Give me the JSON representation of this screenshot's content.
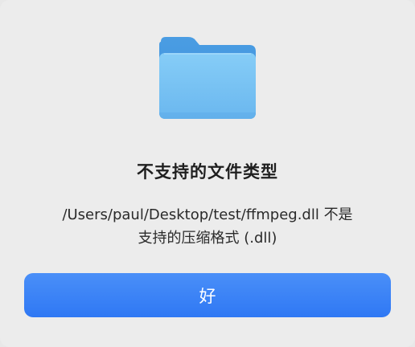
{
  "dialog": {
    "icon": "folder-icon",
    "title": "不支持的文件类型",
    "message_line1": "/Users/paul/Desktop/test/ffmpeg.dll 不是",
    "message_line2": "支持的压缩格式 (.dll)",
    "ok_label": "好"
  },
  "colors": {
    "accent": "#2f78f4",
    "folder_front": "#7cc4f4",
    "folder_back": "#4fa2e6",
    "background": "#ececec"
  }
}
